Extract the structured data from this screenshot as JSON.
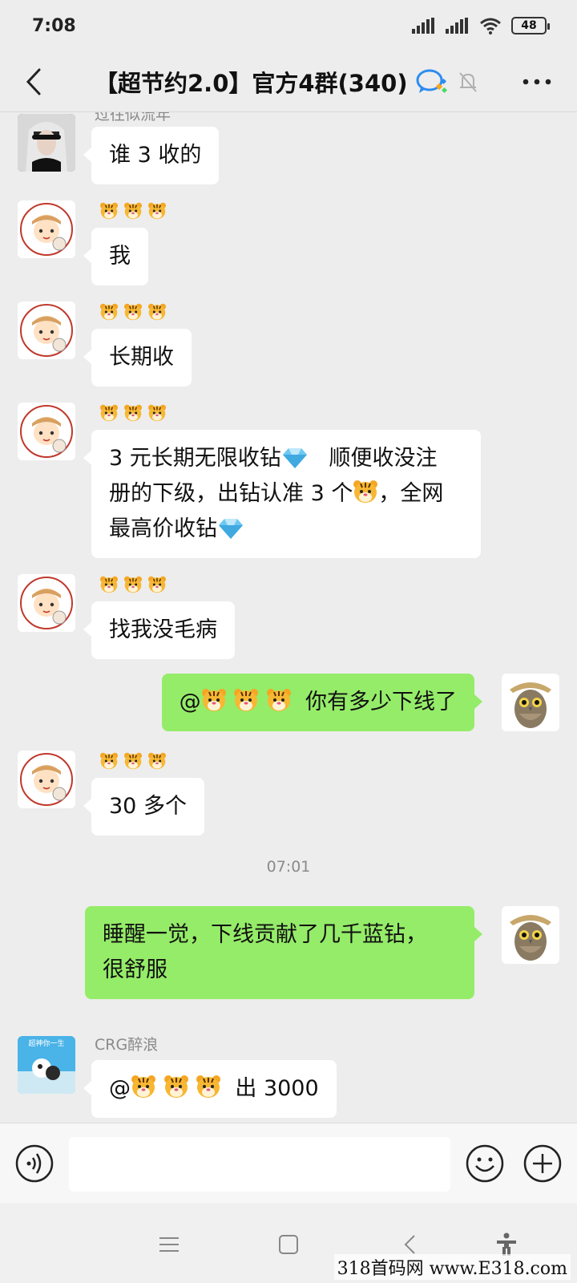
{
  "status": {
    "time": "7:08",
    "battery": "48"
  },
  "header": {
    "title": "【超节约2.0】官方4群(340)"
  },
  "messages": [
    {
      "sender": "过往似流年",
      "text": "谁 3 收的"
    },
    {
      "sender_emoji": "🐯🐯🐯",
      "text": "我"
    },
    {
      "sender_emoji": "🐯🐯🐯",
      "text": "长期收"
    },
    {
      "sender_emoji": "🐯🐯🐯",
      "line1a": "3 元长期无限收钻",
      "line1b": "顺便收没注",
      "line2a": "册的下级，出钻认准 3 个",
      "line2b": "，全网",
      "line3": "最高价收钻"
    },
    {
      "sender_emoji": "🐯🐯🐯",
      "text": "找我没毛病"
    },
    {
      "mention_prefix": "@",
      "text": "你有多少下线了"
    },
    {
      "sender_emoji": "🐯🐯🐯",
      "text": "30 多个"
    },
    {
      "timestamp": "07:01"
    },
    {
      "line1": "睡醒一觉，下线贡献了几千蓝钻，",
      "line2": "很舒服"
    },
    {
      "sender": "CRG醉浪",
      "mention_prefix": "@",
      "text": "出 3000",
      "avatar_caption": "超神你一生"
    }
  ],
  "input": {
    "placeholder": ""
  },
  "watermark": "318首码网 www.E318.com"
}
